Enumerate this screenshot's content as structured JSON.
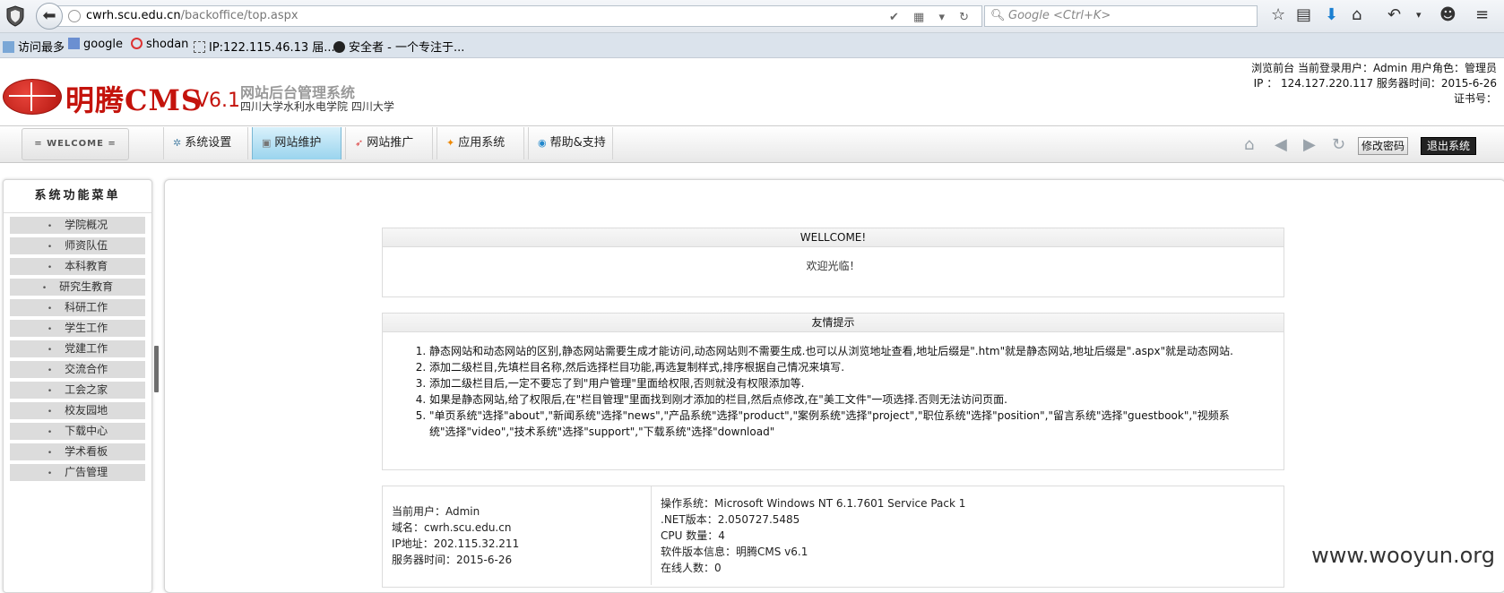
{
  "browser": {
    "url_host": "cwrh.scu.edu.cn",
    "url_path": "/backoffice/top.aspx",
    "search_placeholder": "Google <Ctrl+K>",
    "bookmarks": [
      "访问最多",
      "google",
      "shodan",
      "IP:122.115.46.13 届...",
      "安全者 - 一个专注于..."
    ]
  },
  "header": {
    "logo_text": "明腾CMS",
    "logo_version": "V6.1",
    "system_title": "网站后台管理系统",
    "site_name": "四川大学水利水电学院 四川大学",
    "info_line1": "浏览前台 当前登录用户：Admin 用户角色：管理员",
    "info_line2": "IP ： 124.127.220.117 服务器时间：2015-6-26",
    "info_line3": "证书号："
  },
  "nav": {
    "welcome": "= WELCOME =",
    "tabs": [
      {
        "label": "系统设置",
        "active": false
      },
      {
        "label": "网站维护",
        "active": true
      },
      {
        "label": "网站推广",
        "active": false
      },
      {
        "label": "应用系统",
        "active": false
      },
      {
        "label": "帮助&支持",
        "active": false
      }
    ],
    "change_password": "修改密码",
    "logout": "退出系统"
  },
  "sidebar": {
    "title": "系统功能菜单",
    "items": [
      "学院概况",
      "师资队伍",
      "本科教育",
      "研究生教育",
      "科研工作",
      "学生工作",
      "党建工作",
      "交流合作",
      "工会之家",
      "校友园地",
      "下载中心",
      "学术看板",
      "广告管理"
    ]
  },
  "welcome_box": {
    "title": "WELLCOME!",
    "message": "欢迎光临！"
  },
  "tips_box": {
    "title": "友情提示",
    "items": [
      "静态网站和动态网站的区别,静态网站需要生成才能访问,动态网站则不需要生成.也可以从浏览地址查看,地址后缀是\".htm\"就是静态网站,地址后缀是\".aspx\"就是动态网站.",
      "添加二级栏目,先填栏目名称,然后选择栏目功能,再选复制样式,排序根据自己情况来填写.",
      "添加二级栏目后,一定不要忘了到\"用户管理\"里面给权限,否则就没有权限添加等.",
      "如果是静态网站,给了权限后,在\"栏目管理\"里面找到刚才添加的栏目,然后点修改,在\"美工文件\"一项选择.否则无法访问页面.",
      "\"单页系统\"选择\"about\",\"新闻系统\"选择\"news\",\"产品系统\"选择\"product\",\"案例系统\"选择\"project\",\"职位系统\"选择\"position\",\"留言系统\"选择\"guestbook\",\"视频系统\"选择\"video\",\"技术系统\"选择\"support\",\"下载系统\"选择\"download\""
    ]
  },
  "info_box": {
    "left": [
      "当前用户：Admin",
      "域名：cwrh.scu.edu.cn",
      "IP地址：202.115.32.211",
      "服务器时间：2015-6-26"
    ],
    "right": [
      "操作系统：Microsoft Windows NT 6.1.7601 Service Pack 1",
      ".NET版本：2.050727.5485",
      "CPU 数量：4",
      "软件版本信息：明腾CMS v6.1",
      "在线人数：0"
    ]
  },
  "watermark": "www.wooyun.org"
}
